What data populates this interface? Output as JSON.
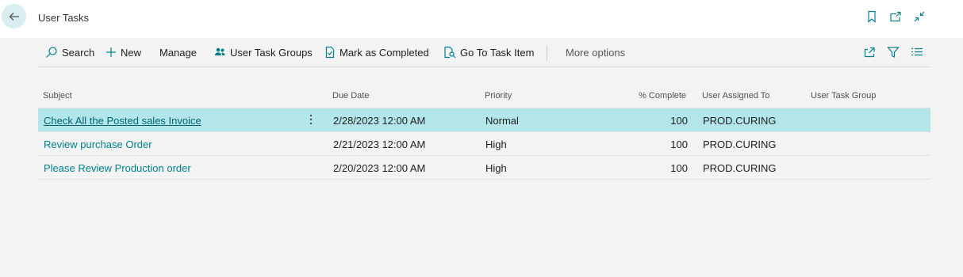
{
  "page": {
    "title": "User Tasks"
  },
  "actions": {
    "search": "Search",
    "new": "New",
    "manage": "Manage",
    "user_task_groups": "User Task Groups",
    "mark_completed": "Mark as Completed",
    "go_to_task_item": "Go To Task Item",
    "more_options": "More options"
  },
  "columns": {
    "subject": "Subject",
    "due_date": "Due Date",
    "priority": "Priority",
    "pct_complete": "% Complete",
    "assigned_to": "User Assigned To",
    "task_group": "User Task Group"
  },
  "rows": [
    {
      "subject": "Check All the Posted sales Invoice",
      "due_date": "2/28/2023 12:00 AM",
      "priority": "Normal",
      "pct_complete": "100",
      "assigned_to": "PROD.CURING",
      "task_group": ""
    },
    {
      "subject": "Review purchase Order",
      "due_date": "2/21/2023 12:00 AM",
      "priority": "High",
      "pct_complete": "100",
      "assigned_to": "PROD.CURING",
      "task_group": ""
    },
    {
      "subject": "Please Review Production order",
      "due_date": "2/20/2023 12:00 AM",
      "priority": "High",
      "pct_complete": "100",
      "assigned_to": "PROD.CURING",
      "task_group": ""
    }
  ],
  "colors": {
    "accent": "#00818b",
    "selected_row": "#b2e6ea",
    "back_button_bg": "#d9eef0"
  }
}
